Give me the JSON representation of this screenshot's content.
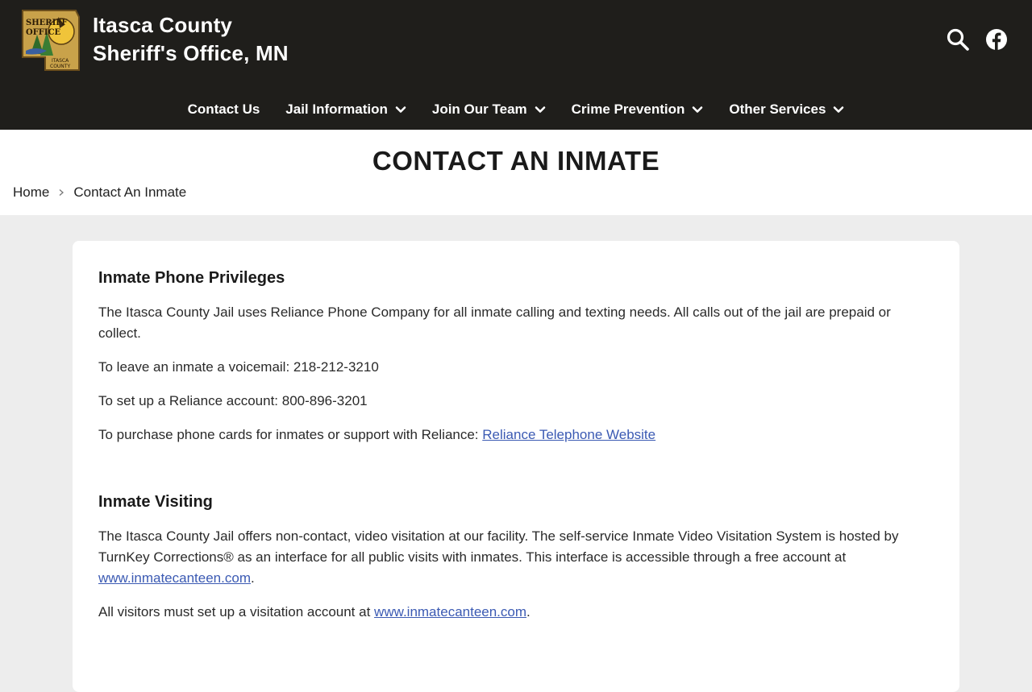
{
  "header": {
    "title_line1": "Itasca County",
    "title_line2": "Sheriff's Office, MN",
    "logo_icon": "sheriff-office-badge",
    "search_icon": "search-icon",
    "facebook_icon": "facebook-icon"
  },
  "nav": {
    "items": [
      {
        "label": "Contact Us",
        "dropdown": false
      },
      {
        "label": "Jail Information",
        "dropdown": true
      },
      {
        "label": "Join Our Team",
        "dropdown": true
      },
      {
        "label": "Crime Prevention",
        "dropdown": true
      },
      {
        "label": "Other Services",
        "dropdown": true
      }
    ]
  },
  "page": {
    "title": "CONTACT AN INMATE",
    "breadcrumb": {
      "home": "Home",
      "current": "Contact An Inmate"
    }
  },
  "content": {
    "phone": {
      "heading": "Inmate Phone Privileges",
      "p1": "The Itasca County Jail uses Reliance Phone Company for all inmate calling and texting needs.  All calls out of the jail are prepaid or collect.",
      "p2": "To leave an inmate a voicemail: 218-212-3210",
      "p3": "To set up a Reliance account: 800-896-3201",
      "p4_text": "To purchase phone cards for inmates or support with Reliance: ",
      "p4_link": "Reliance Telephone Website"
    },
    "visiting": {
      "heading": "Inmate Visiting",
      "p1_text": "The Itasca County Jail offers non-contact, video visitation at our facility. The self-service Inmate Video Visitation System is hosted by TurnKey Corrections® as an interface for all public visits with inmates. This interface is accessible through a free account at ",
      "p1_link": "www.inmatecanteen.com",
      "p1_end": ".",
      "p2_text": "All visitors must set up a visitation account at ",
      "p2_link": "www.inmatecanteen.com",
      "p2_end": "."
    }
  },
  "colors": {
    "header_bg": "#1f1e1b",
    "link": "#3b5ab3",
    "page_bg": "#ededed"
  }
}
